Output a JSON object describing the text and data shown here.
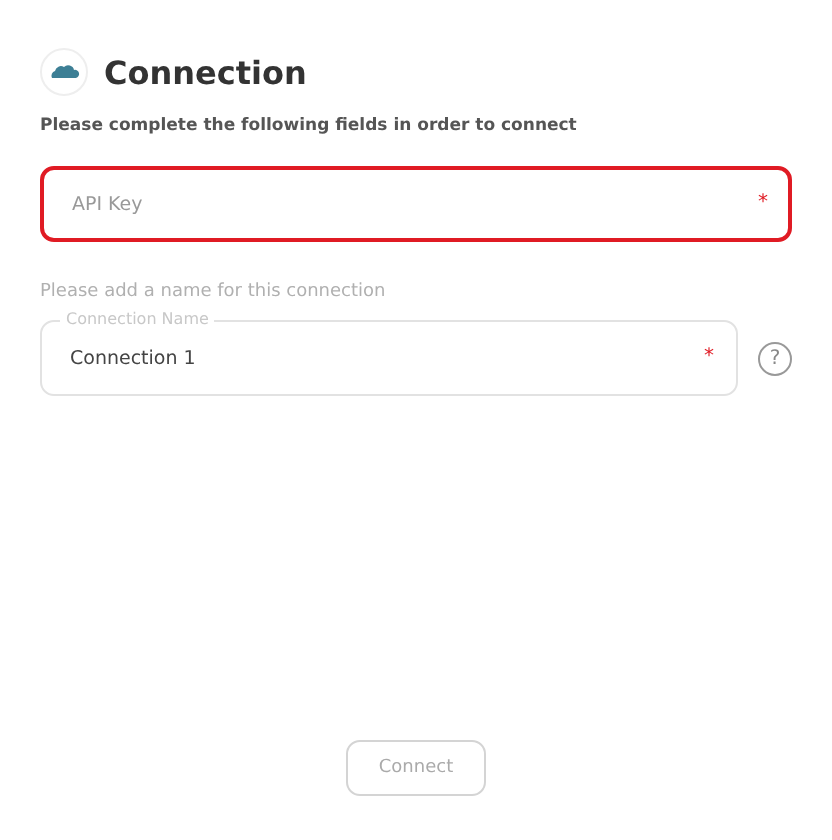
{
  "header": {
    "title": "Connection",
    "subtitle": "Please complete the following fields in order to connect"
  },
  "fields": [
    {
      "kind": "plain",
      "placeholder": "API Key",
      "required_mark": "*",
      "error": true
    },
    {
      "kind": "labeled",
      "hint": "Please add a name for this connection",
      "label": "Connection Name",
      "value": "Connection 1",
      "required_mark": "*",
      "error": false,
      "help": "?"
    }
  ],
  "connect_button": {
    "label": "Connect",
    "disabled": true
  }
}
